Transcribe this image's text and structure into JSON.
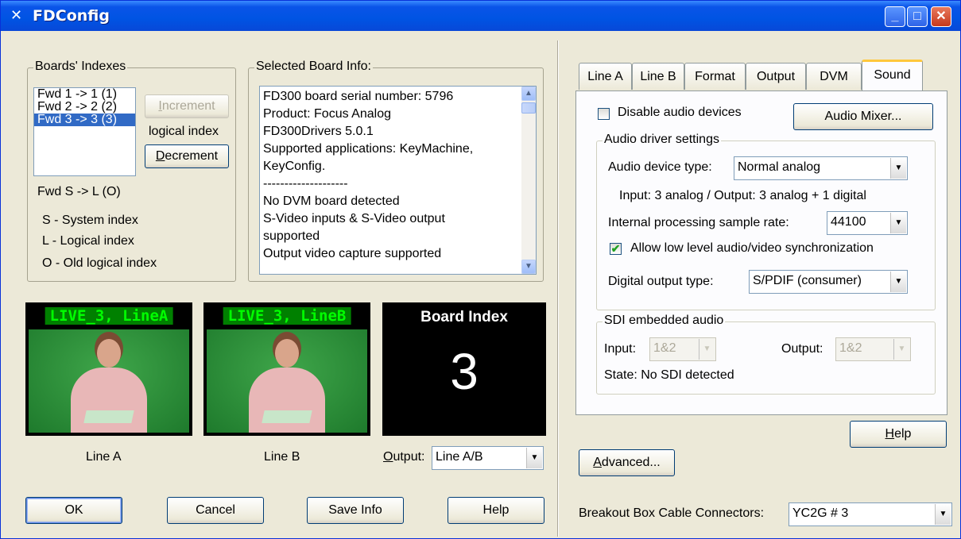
{
  "window": {
    "title": "FDConfig",
    "minimize_label": "_",
    "maximize_label": "□",
    "close_label": "✕"
  },
  "boards": {
    "legend": "Boards' Indexes",
    "items": [
      "Fwd 1 -> 1 (1)",
      "Fwd 2 -> 2 (2)",
      "Fwd 3 -> 3 (3)"
    ],
    "selected_index": 2,
    "increment_label": "Increment",
    "logical_index_label": "logical index",
    "decrement_label": "Decrement",
    "fwd_label": "Fwd S -> L (O)",
    "key_s": "S - System index",
    "key_l": "L - Logical index",
    "key_o": "O - Old logical index"
  },
  "info": {
    "legend": "Selected Board Info:",
    "lines": [
      "FD300 board serial number: 5796",
      "Product: Focus Analog",
      "FD300Drivers 5.0.1",
      "Supported applications: KeyMachine,",
      "KeyConfig.",
      "--------------------",
      "No DVM board detected",
      "S-Video inputs & S-Video output",
      "supported",
      "Output video capture supported"
    ]
  },
  "previews": {
    "line_a_overlay": "LIVE_3, LineA",
    "line_b_overlay": "LIVE_3, LineB",
    "line_a_caption": "Line A",
    "line_b_caption": "Line B",
    "board_index_title": "Board Index",
    "board_index_value": "3",
    "output_label": "Output:",
    "output_value": "Line A/B"
  },
  "bottom_buttons": {
    "ok": "OK",
    "cancel": "Cancel",
    "save_info": "Save Info",
    "help": "Help"
  },
  "tabs": [
    "Line A",
    "Line B",
    "Format",
    "Output",
    "DVM",
    "Sound"
  ],
  "active_tab": "Sound",
  "sound": {
    "disable_audio_label": "Disable audio devices",
    "disable_audio_checked": false,
    "audio_mixer_label": "Audio Mixer...",
    "driver_legend": "Audio driver settings",
    "device_type_label": "Audio device type:",
    "device_type_value": "Normal analog",
    "io_info": "Input: 3 analog / Output: 3 analog + 1 digital",
    "sample_rate_label": "Internal processing sample rate:",
    "sample_rate_value": "44100",
    "allow_sync_label": "Allow low level audio/video synchronization",
    "allow_sync_checked": true,
    "digital_output_label": "Digital output type:",
    "digital_output_value": "S/PDIF (consumer)",
    "sdi_legend": "SDI embedded audio",
    "sdi_input_label": "Input:",
    "sdi_input_value": "1&2",
    "sdi_output_label": "Output:",
    "sdi_output_value": "1&2",
    "sdi_state": "State: No SDI detected"
  },
  "right_buttons": {
    "help": "Help",
    "advanced": "Advanced..."
  },
  "breakout": {
    "label": "Breakout Box Cable Connectors:",
    "value": "YC2G # 3"
  },
  "colors": {
    "titlebar": "#0054e3",
    "window_bg": "#ece9d8",
    "selection": "#316ac5",
    "overlay_green": "#00ff00"
  }
}
